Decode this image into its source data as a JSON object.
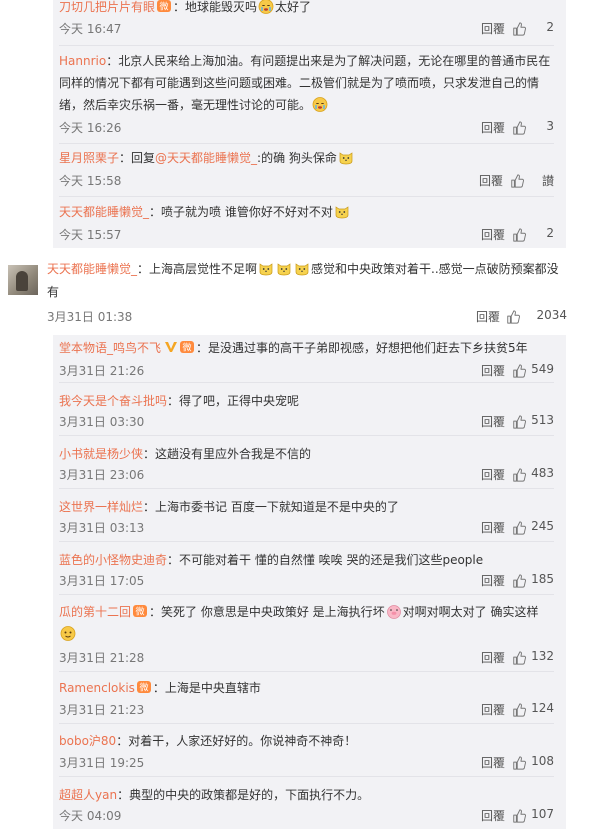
{
  "labels": {
    "reply": "回覆",
    "like": "讃"
  },
  "colors": {
    "username": "#eb7350",
    "block_bg": "#f2f2f5"
  },
  "block1": [
    {
      "user": "刀切几把片片有眼",
      "text": "：地球能毁灭吗",
      "text2": "太好了",
      "time": "今天 16:47",
      "likes": "2"
    },
    {
      "user": "Hannrio",
      "text": "：北京人民来给上海加油。有问题提出来是为了解决问题，无论在哪里的普通市民在同样的情况下都有可能遇到这些问题或困难。二极管们就是为了喷而喷，只求发泄自己的情绪，然后幸灾乐祸一番，毫无理性讨论的可能。",
      "time": "今天 16:26",
      "likes": "3"
    },
    {
      "user": "星月照栗子",
      "text": "：回复",
      "mention": "@天天都能睡懒觉_",
      "text2": ":的确 狗头保命",
      "time": "今天 15:58",
      "likes": "讃"
    },
    {
      "user": "天天都能睡懒觉_",
      "text": "：喷子就为喷 谁管你好不好对不对",
      "time": "今天 15:57",
      "likes": "2"
    }
  ],
  "top_comment": {
    "user": "天天都能睡懒觉_",
    "text": "：上海高层觉性不足啊",
    "text2": "感觉和中央政策对着干..感觉一点破防预案都没有",
    "time": "3月31日 01:38",
    "likes": "2034"
  },
  "block2": [
    {
      "user": "堂本物语_鸣鸟不飞",
      "text": "：是没遇过事的高干子弟即视感，好想把他们赶去下乡扶贫5年",
      "time": "3月31日 21:26",
      "likes": "549"
    },
    {
      "user": "我今天是个奋斗批吗",
      "text": "：得了吧，正得中央宠呢",
      "time": "3月31日 03:30",
      "likes": "513"
    },
    {
      "user": "小书就是杨少侠",
      "text": "：这趟没有里应外合我是不信的",
      "time": "3月31日 23:06",
      "likes": "483"
    },
    {
      "user": "这世界一样灿烂",
      "text": "：上海市委书记 百度一下就知道是不是中央的了",
      "time": "3月31日 03:13",
      "likes": "245"
    },
    {
      "user": "蓝色的小怪物史迪奇",
      "text": "：不可能对着干 懂的自然懂 唉唉 哭的还是我们这些people",
      "time": "3月31日 17:05",
      "likes": "185"
    },
    {
      "user": "瓜的第十二回",
      "text": "：笑死了 你意思是中央政策好 是上海执行坏",
      "text2": "对啊对啊太对了 确实这样",
      "time": "3月31日 21:28",
      "likes": "132"
    },
    {
      "user": "Ramenclokis",
      "text": "：上海是中央直辖市",
      "time": "3月31日 21:23",
      "likes": "124"
    },
    {
      "user": "bobo沪80",
      "text": "：对着干，人家还好好的。你说神奇不神奇！",
      "time": "3月31日 19:25",
      "likes": "108"
    },
    {
      "user": "超超人yan",
      "text": "：典型的中央的政策都是好的，下面执行不力。",
      "time": "今天 04:09",
      "likes": "107"
    }
  ]
}
